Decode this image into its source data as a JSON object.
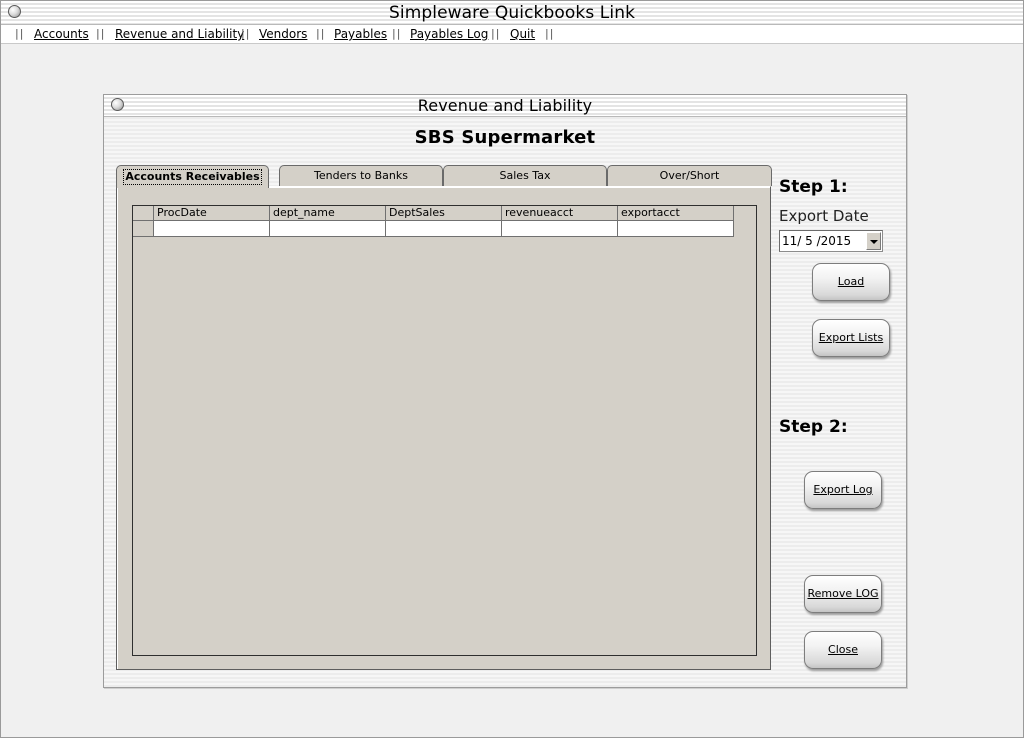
{
  "app": {
    "title": "Simpleware Quickbooks Link"
  },
  "menu": {
    "items": [
      {
        "label": "Accounts"
      },
      {
        "label": "Revenue and Liability"
      },
      {
        "label": "Vendors"
      },
      {
        "label": "Payables"
      },
      {
        "label": "Payables Log"
      },
      {
        "label": "Quit"
      }
    ],
    "separator": "||"
  },
  "window": {
    "title": "Revenue and Liability",
    "company": "SBS Supermarket"
  },
  "tabs": [
    {
      "label": "Accounts Receivables",
      "active": true
    },
    {
      "label": "Tenders to Banks",
      "active": false
    },
    {
      "label": "Sales Tax",
      "active": false
    },
    {
      "label": "Over/Short",
      "active": false
    }
  ],
  "grid": {
    "columns": [
      "ProcDate",
      "dept_name",
      "DeptSales",
      "revenueacct",
      "exportacct"
    ],
    "rows": [
      [
        "",
        "",
        "",
        "",
        ""
      ]
    ]
  },
  "controls": {
    "step1": "Step 1:",
    "export_date_label": "Export Date",
    "export_date_value": "11/ 5 /2015",
    "load": "Load",
    "export_lists": "Export Lists",
    "step2": "Step 2:",
    "export_log": "Export Log",
    "remove_log": "Remove LOG",
    "close": "Close"
  }
}
